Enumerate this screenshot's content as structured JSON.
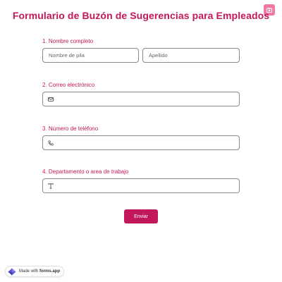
{
  "form": {
    "title": "Formulario de Buzón de Sugerencias para Empleados",
    "questions": [
      {
        "label": "1.  Nombre completo"
      },
      {
        "label": "2.  Correo electrónico"
      },
      {
        "label": "3.  Número de teléfono"
      },
      {
        "label": "4.  Departamento o area de trabajo"
      }
    ],
    "first_name": {
      "placeholder": "Nombre de pila",
      "value": ""
    },
    "last_name": {
      "placeholder": "Apellido",
      "value": ""
    },
    "email": {
      "value": ""
    },
    "phone": {
      "value": ""
    },
    "department": {
      "value": ""
    },
    "submit_label": "Enviar"
  },
  "badge": {
    "prefix": "Made with ",
    "brand": "forms.app"
  },
  "icons": {
    "top_right": "image-icon",
    "email": "envelope-icon",
    "phone": "phone-icon",
    "department": "text-icon",
    "badge": "forms-app-logo-icon"
  },
  "colors": {
    "accent": "#c2185b",
    "top_button": "#f07aa3",
    "field_border": "#8a8a8a"
  }
}
